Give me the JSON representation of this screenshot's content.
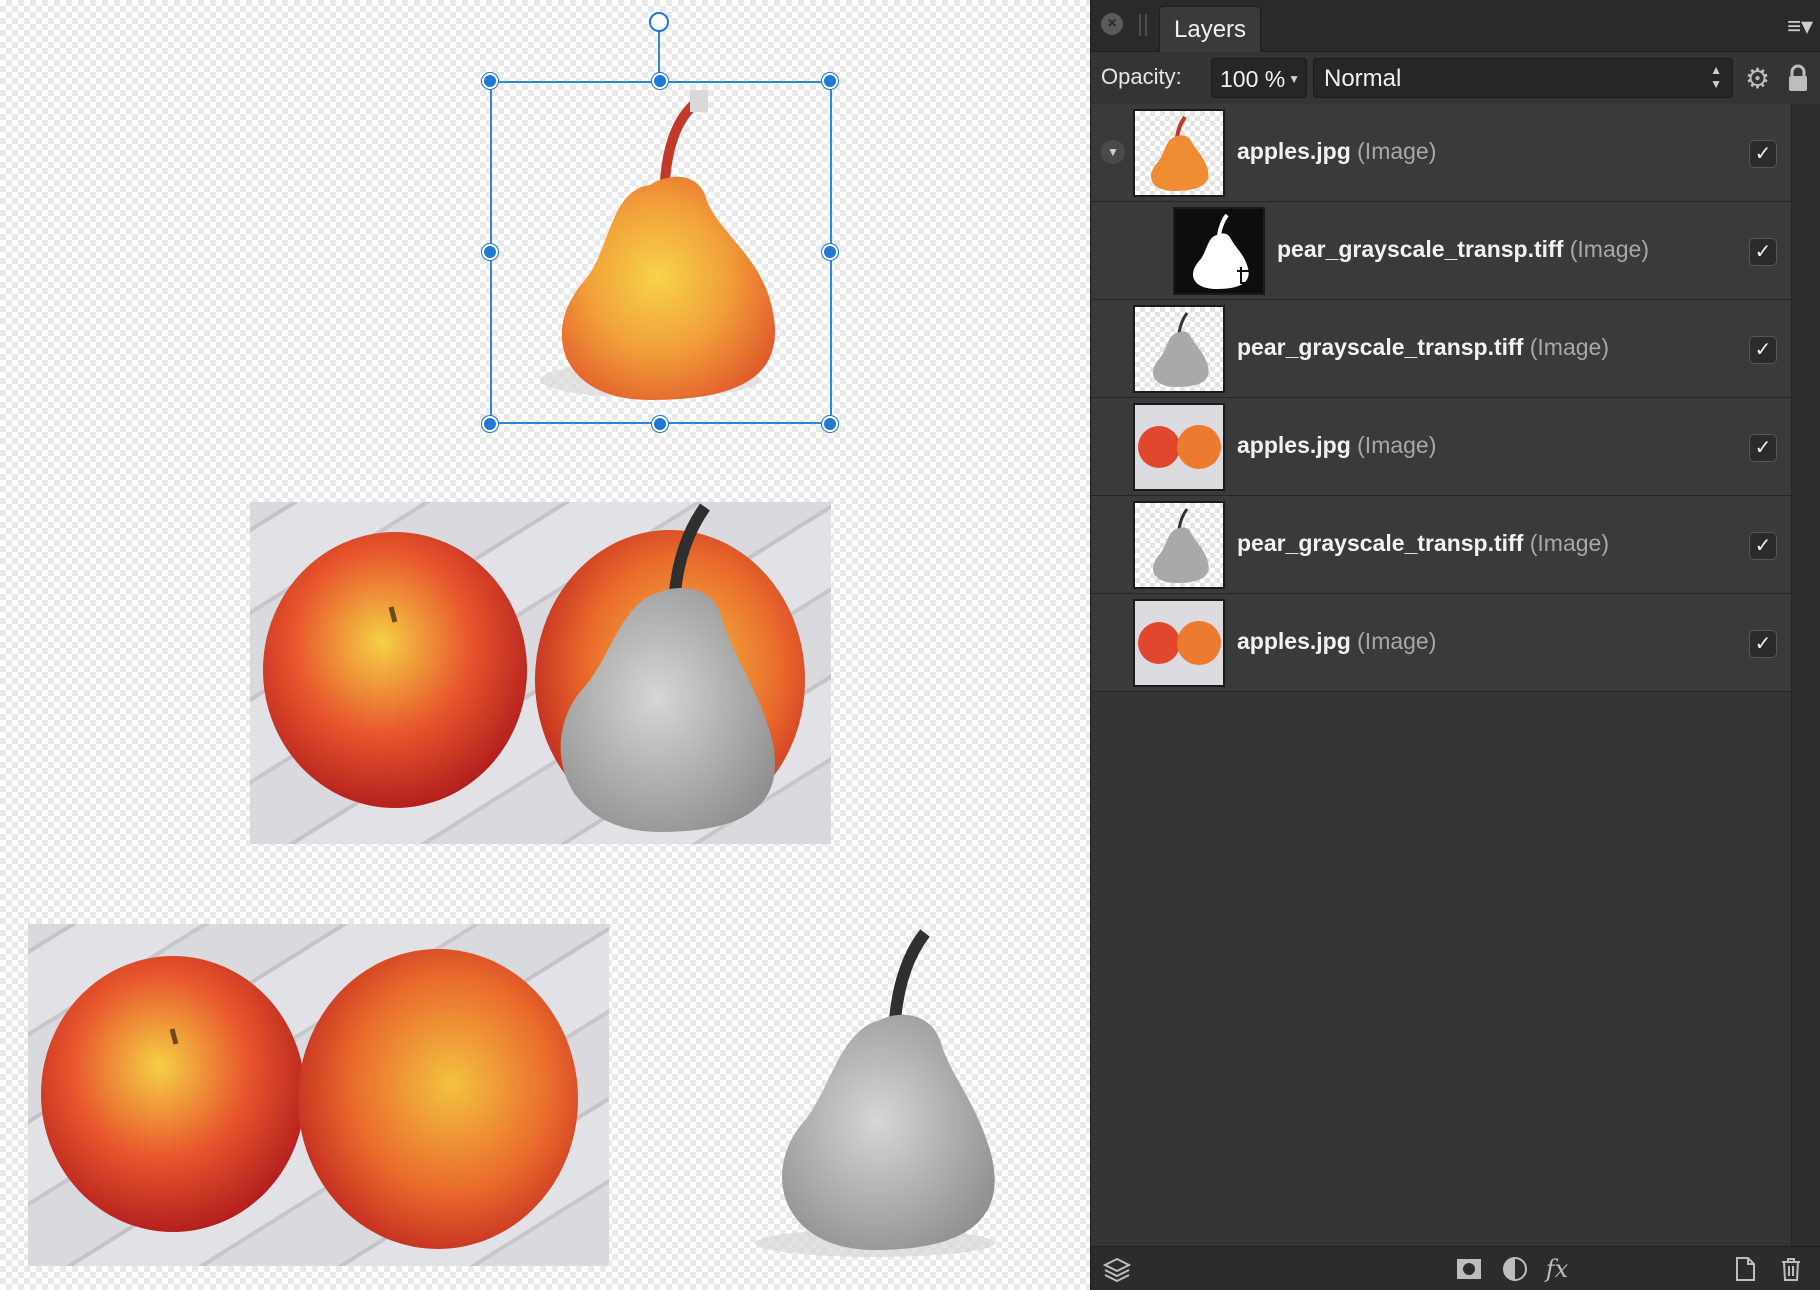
{
  "panel": {
    "tab_label": "Layers",
    "opacity_label": "Opacity:",
    "opacity_value": "100 %",
    "blend_mode": "Normal"
  },
  "layers": [
    {
      "name": "apples.jpg",
      "type": "(Image)",
      "visible": "✓"
    },
    {
      "name": "pear_grayscale_transp.tiff",
      "type": "(Image)",
      "visible": "✓"
    },
    {
      "name": "pear_grayscale_transp.tiff",
      "type": "(Image)",
      "visible": "✓"
    },
    {
      "name": "apples.jpg",
      "type": "(Image)",
      "visible": "✓"
    },
    {
      "name": "pear_grayscale_transp.tiff",
      "type": "(Image)",
      "visible": "✓"
    },
    {
      "name": "apples.jpg",
      "type": "(Image)",
      "visible": "✓"
    }
  ],
  "footer_icons": [
    "layers-icon",
    "mask-icon",
    "adjustment-icon",
    "fx-icon",
    "new-document-icon",
    "trash-icon"
  ],
  "colors": {
    "panel_bg": "#343434",
    "selection": "#1f78d1",
    "apple_red": "#d8322a",
    "apple_yellow": "#f0b93a",
    "pear_gray": "#a7a7a7"
  }
}
